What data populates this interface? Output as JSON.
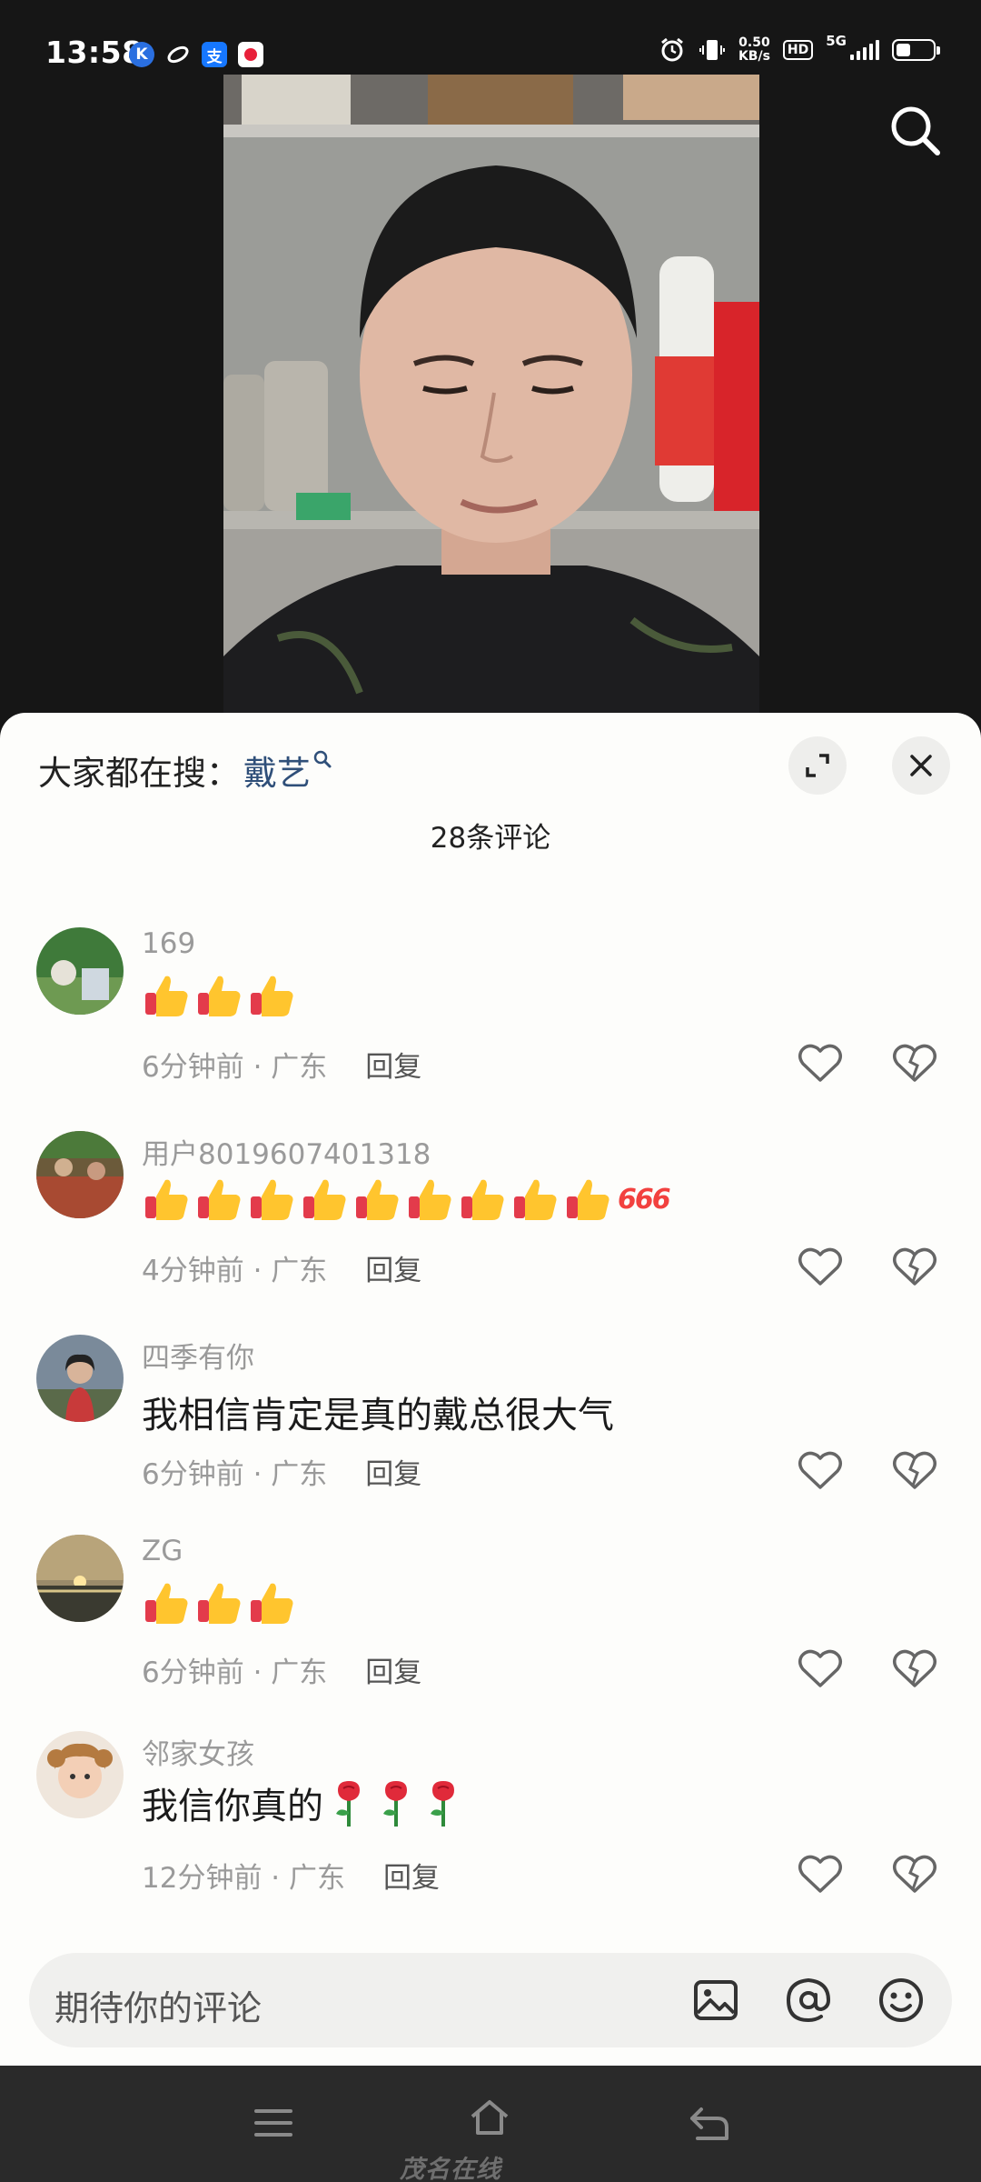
{
  "status_bar": {
    "time": "13:58",
    "net_speed_value": "0.50",
    "net_speed_unit": "KB/s",
    "hd_label": "HD",
    "network": "5G",
    "apps": [
      {
        "icon": "k-app-icon",
        "glyph": "K",
        "color": "#2a6fe0"
      },
      {
        "icon": "swirl-app-icon",
        "glyph": "",
        "color": "#161616"
      },
      {
        "icon": "alipay-icon",
        "glyph": "支",
        "color": "#1677ff"
      },
      {
        "icon": "red-app-icon",
        "glyph": "",
        "color": "#e8203a"
      }
    ]
  },
  "video": {
    "search_icon": "search-icon"
  },
  "panel": {
    "hot_search_label": "大家都在搜：",
    "hot_search_term": "戴艺",
    "comment_count": "28条评论",
    "expand_icon": "expand-icon",
    "close_icon": "close-icon"
  },
  "comments": [
    {
      "user": "169",
      "text": "",
      "emojis": "👍👍👍",
      "time": "6分钟前",
      "location": "广东",
      "reply": "回复"
    },
    {
      "user": "用户8019607401318",
      "text": "",
      "emojis": "👍👍👍👍👍👍👍👍👍666",
      "time": "4分钟前",
      "location": "广东",
      "reply": "回复"
    },
    {
      "user": "四季有你",
      "text": "我相信肯定是真的戴总很大气",
      "emojis": "",
      "time": "6分钟前",
      "location": "广东",
      "reply": "回复"
    },
    {
      "user": "ZG",
      "text": "",
      "emojis": "👍👍👍",
      "time": "6分钟前",
      "location": "广东",
      "reply": "回复"
    },
    {
      "user": "邻家女孩",
      "text": "我信你真的",
      "emojis": "🌹🌹🌹",
      "time": "12分钟前",
      "location": "广东",
      "reply": "回复"
    }
  ],
  "input": {
    "placeholder": "期待你的评论",
    "image_icon": "image-icon",
    "at_icon": "at-icon",
    "emoji_icon": "emoji-icon"
  },
  "nav": {
    "menu_icon": "menu-icon",
    "home_icon": "home-icon",
    "back_icon": "back-icon",
    "watermark": "茂名在线"
  }
}
